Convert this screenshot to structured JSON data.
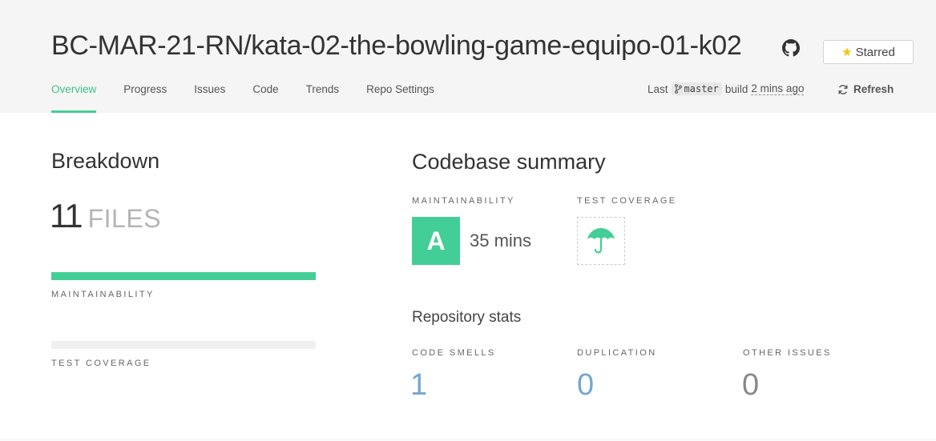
{
  "repo": {
    "title": "BC-MAR-21-RN/kata-02-the-bowling-game-equipo-01-k02",
    "star_label": "Starred"
  },
  "nav": {
    "items": [
      "Overview",
      "Progress",
      "Issues",
      "Code",
      "Trends",
      "Repo Settings"
    ],
    "active": "Overview"
  },
  "build": {
    "prefix": "Last",
    "branch": "master",
    "middle": "build",
    "time": "2 mins ago",
    "refresh_label": "Refresh"
  },
  "breakdown": {
    "title": "Breakdown",
    "files_count": "11",
    "files_unit": "FILES",
    "maintainability_label": "MAINTAINABILITY",
    "maintainability_fill": 1.0,
    "test_coverage_label": "TEST COVERAGE",
    "test_coverage_fill": 0.0
  },
  "summary": {
    "title": "Codebase summary",
    "maintainability_label": "MAINTAINABILITY",
    "grade": "A",
    "grade_time": "35 mins",
    "test_coverage_label": "TEST COVERAGE",
    "coverage_icon": "umbrella-icon"
  },
  "stats": {
    "title": "Repository stats",
    "code_smells_label": "CODE SMELLS",
    "code_smells": "1",
    "duplication_label": "DUPLICATION",
    "duplication": "0",
    "other_issues_label": "OTHER ISSUES",
    "other_issues": "0"
  },
  "colors": {
    "accent": "#44ce97",
    "link_blue": "#74a7cf",
    "star": "#f0c400"
  }
}
